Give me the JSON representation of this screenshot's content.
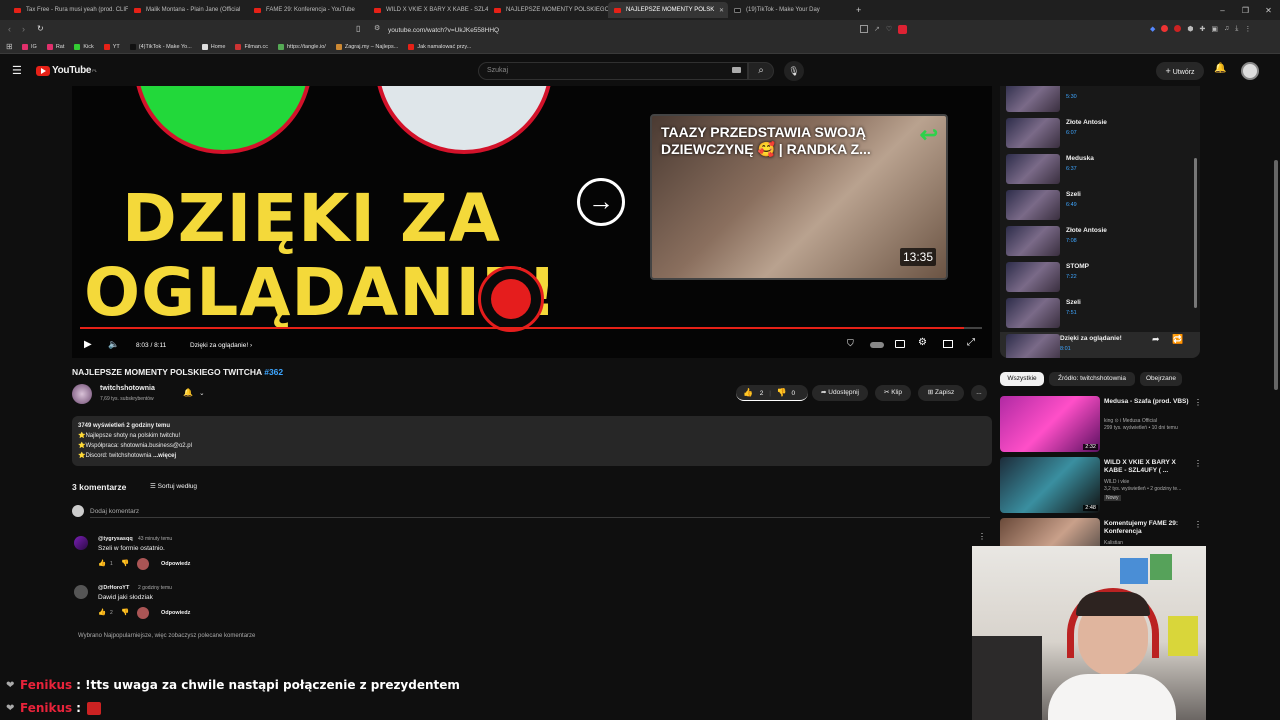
{
  "browser": {
    "tabs": [
      {
        "title": "Tax Free - Rura musi yeah (prod. CLIF",
        "icon": "youtube-icon"
      },
      {
        "title": "Malik Montana - Plain Jane (Official",
        "icon": "youtube-icon"
      },
      {
        "title": "FAME 29: Konferencja - YouTube",
        "icon": "youtube-icon"
      },
      {
        "title": "WILD X VKIE X BARY X KABE - SZL4U",
        "icon": "youtube-icon"
      },
      {
        "title": "NAJLEPSZE MOMENTY POLSKIEGO T",
        "icon": "youtube-icon"
      },
      {
        "title": "NAJLEPSZE MOMENTY POLSK",
        "icon": "youtube-icon",
        "active": true
      },
      {
        "title": "(19)TikTok - Make Your Day",
        "icon": "tiktok-icon"
      }
    ],
    "new_tab": "+",
    "url": "youtube.com/watch?v=UkJKe558HHQ",
    "bookmarks": [
      "IG",
      "Rat",
      "Kick",
      "YT",
      "(4)TikTok - Make Yo...",
      "Home",
      "Filman.cc",
      "https://tangle.io/",
      "Zagraj.my – Najleps...",
      "Jak namalować przy..."
    ]
  },
  "youtube": {
    "logo_text": "YouTube",
    "logo_sup": "PL",
    "search_placeholder": "Szukaj",
    "create_label": "Utwórz"
  },
  "player": {
    "overlay_text_line1": "DZIĘKI ZA",
    "overlay_text_line2": "OGLĄDANIE!",
    "endcard_title": "TAAZY PRZEDSTAWIA SWOJĄ DZIEWCZYNĘ 🥰 | RANDKA Z...",
    "endcard_duration": "13:35",
    "time": "8:03 / 8:11",
    "chapter": "Dzięki za oglądanie!",
    "chapter_chevron": "›",
    "progress": 0.98
  },
  "video": {
    "title": "NAJLEPSZE MOMENTY POLSKIEGO TWITCHA",
    "title_tag": "#362",
    "channel": "twitchshotownia",
    "subscribers": "7,69 tys. subskrybentów",
    "likes": "2",
    "dislikes": "0",
    "share_label": "Udostępnij",
    "clip_label": "Klip",
    "save_label": "Zapisz",
    "more_label": "...",
    "description": {
      "stats": "3749 wyświetleń  2 godziny temu",
      "line1": "⭐Najlepsze shoty na polskim twitchu!",
      "line2": "⭐Współpraca: shotownia.business@o2.pl",
      "line3": "⭐Discord: twitchshotownia",
      "more": "...więcej"
    }
  },
  "comments": {
    "count_label": "3 komentarze",
    "sort_label": "Sortuj według",
    "add_placeholder": "Dodaj komentarz",
    "items": [
      {
        "author": "@tygrysasqq",
        "time": "43 minuty temu",
        "text": "Szeli w formie ostatnio.",
        "likes": "1",
        "reply": "Odpowiedz"
      },
      {
        "author": "@DrHoroYT",
        "time": "2 godziny temu",
        "text": "Dawid jaki słodziak",
        "likes": "2",
        "reply": "Odpowiedz"
      }
    ],
    "footer": "Wybrano Najpopularniejsze, więc zobaczysz polecane komentarze"
  },
  "playlist": {
    "items": [
      {
        "name": "",
        "duration": "5:30"
      },
      {
        "name": "Złote Antosie",
        "duration": "6:07"
      },
      {
        "name": "Meduska",
        "duration": "6:37"
      },
      {
        "name": "Szeli",
        "duration": "6:49"
      },
      {
        "name": "Złote Antosie",
        "duration": "7:08"
      },
      {
        "name": "STOMP",
        "duration": "7:22"
      },
      {
        "name": "Szeli",
        "duration": "7:51"
      },
      {
        "name": "Dzięki za oglądanie!",
        "duration": "8:01"
      }
    ]
  },
  "filters": [
    "Wszystkie",
    "Źródło: twitchshotownia",
    "Obejrzane"
  ],
  "recommended": [
    {
      "title": "Medusa - Szafa (prod. VBS)",
      "channel": "king ⊙ i Medusa Official",
      "meta": "299 tys. wyświetleń • 10 dni temu",
      "duration": "2:32",
      "badge": ""
    },
    {
      "title": "WILD X VKIE X BARY X KABE - SZL4UFY ( ...",
      "channel": "WILD i vkie",
      "meta": "3,2 tys. wyświetleń • 2 godziny te...",
      "duration": "2:48",
      "badge": "Nowy"
    },
    {
      "title": "Komentujemy FAME 29: Konferencja",
      "channel": "Kalistian",
      "meta": "",
      "duration": "",
      "badge": ""
    }
  ],
  "chat": [
    {
      "user": "Fenikus",
      "message": ": !tts uwaga za chwile nastąpi połączenie z prezydentem"
    },
    {
      "user": "Fenikus",
      "message": ":"
    }
  ],
  "colors": {
    "accent": "#e62117",
    "link": "#3ea6ff",
    "bg": "#0f0f0f",
    "chip": "#272727",
    "chat_name": "#e8233a",
    "overlay_yellow": "#f4d93a"
  }
}
